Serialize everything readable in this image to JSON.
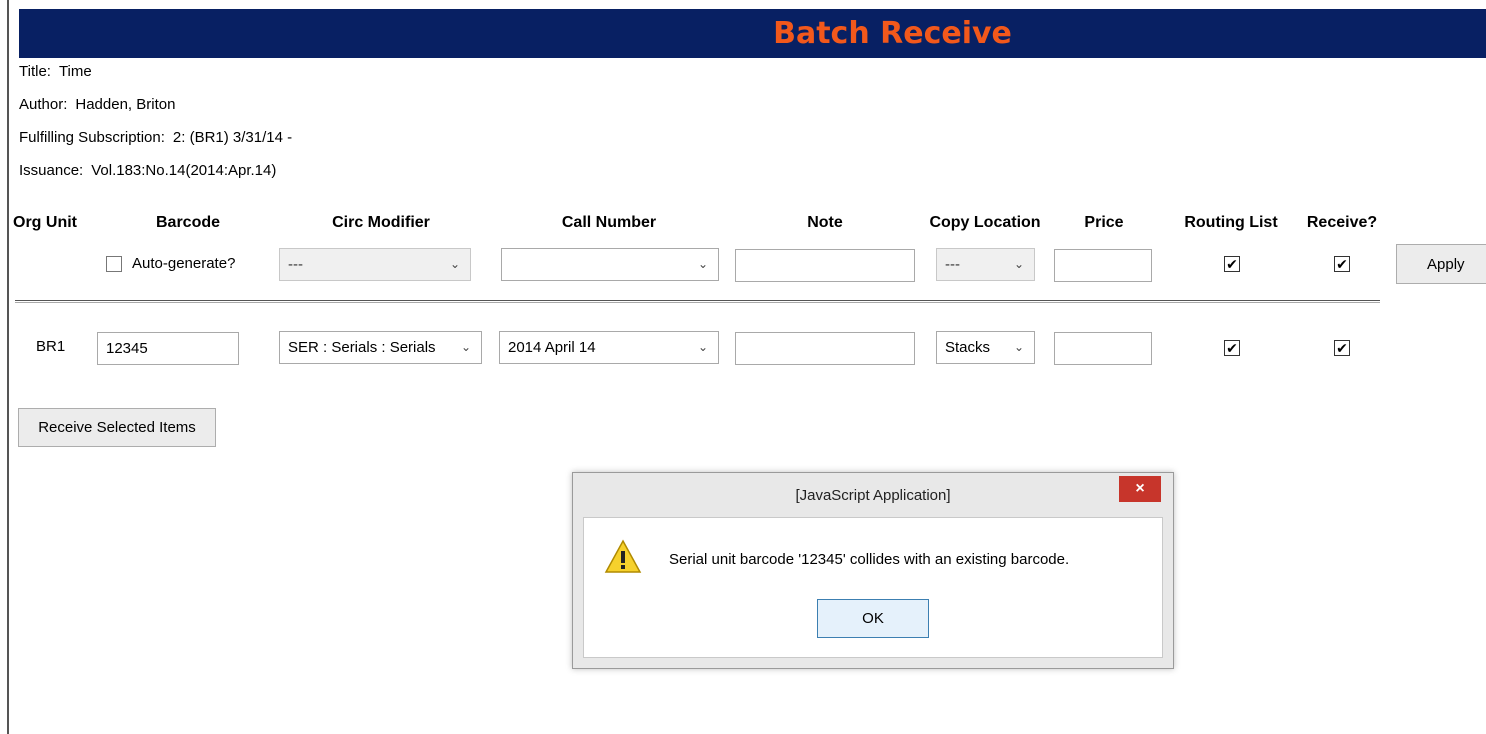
{
  "header": {
    "title": "Batch Receive"
  },
  "info": {
    "title_label": "Title:",
    "title_value": "Time",
    "author_label": "Author:",
    "author_value": "Hadden, Briton",
    "subscription_label": "Fulfilling Subscription:",
    "subscription_value": "2: (BR1) 3/31/14 -",
    "issuance_label": "Issuance:",
    "issuance_value": "Vol.183:No.14(2014:Apr.14)"
  },
  "columns": {
    "org_unit": "Org Unit",
    "barcode": "Barcode",
    "circ_modifier": "Circ Modifier",
    "call_number": "Call Number",
    "note": "Note",
    "copy_location": "Copy Location",
    "price": "Price",
    "routing_list": "Routing List",
    "receive": "Receive?"
  },
  "batch_row": {
    "auto_generate_label": "Auto-generate?",
    "auto_generate_checked": false,
    "circ_modifier": "---",
    "call_number": "",
    "note": "",
    "copy_location": "---",
    "price": "",
    "routing_list_checked": true,
    "receive_checked": true,
    "apply_label": "Apply"
  },
  "item_row": {
    "org_unit": "BR1",
    "barcode": "12345",
    "circ_modifier": "SER : Serials : Serials",
    "call_number": "2014 April 14",
    "note": "",
    "copy_location": "Stacks",
    "price": "",
    "routing_list_checked": true,
    "receive_checked": true
  },
  "receive_button_label": "Receive Selected Items",
  "dialog": {
    "title": "[JavaScript Application]",
    "close_glyph": "×",
    "message": "Serial unit barcode '12345' collides with an existing barcode.",
    "ok_label": "OK",
    "icon": "warning-icon"
  },
  "colors": {
    "header_bg": "#082063",
    "header_text": "#f2581b",
    "close_button": "#c7352b"
  }
}
